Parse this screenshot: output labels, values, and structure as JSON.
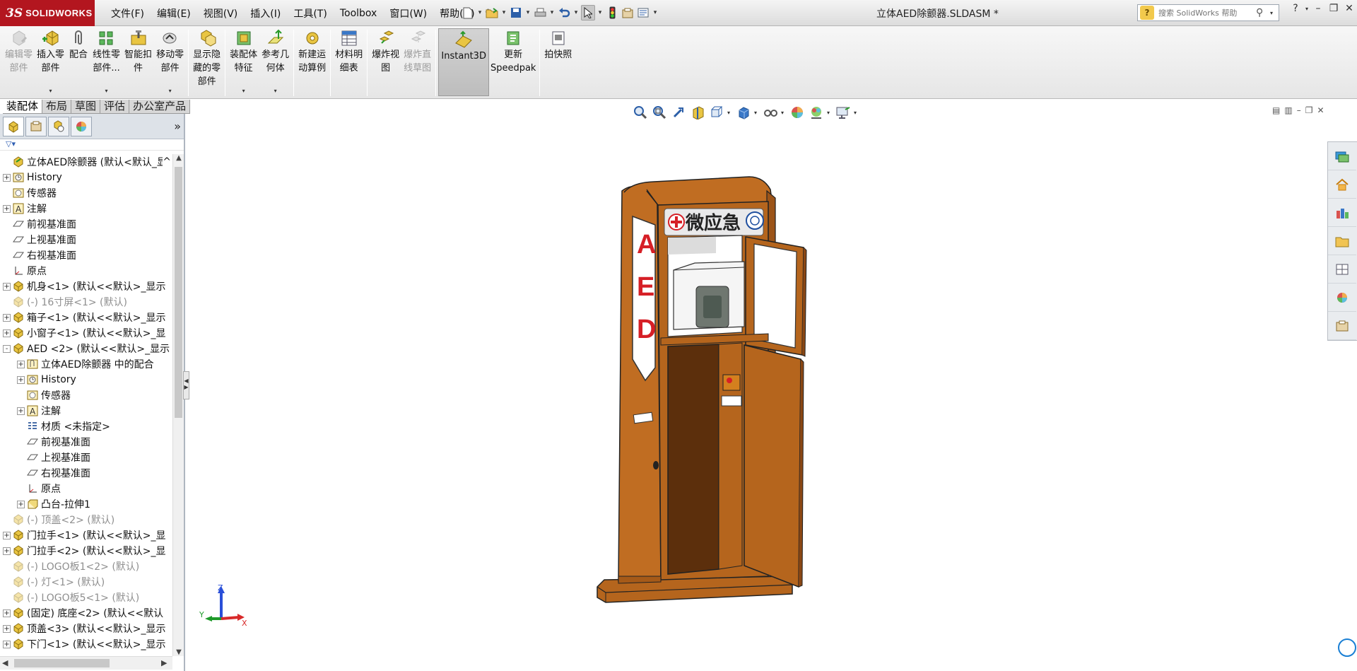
{
  "app": {
    "logo_ds": "3S",
    "logo_brand": "SOLIDWORKS",
    "document_title": "立体AED除颤器.SLDASM *",
    "menu": [
      "文件(F)",
      "编辑(E)",
      "视图(V)",
      "插入(I)",
      "工具(T)",
      "Toolbox",
      "窗口(W)",
      "帮助(H)"
    ],
    "search_placeholder": "搜索 SolidWorks 帮助"
  },
  "ribbon": {
    "edit_part": "编辑零\n部件",
    "insert_parts": "插入零\n部件",
    "mate": "配合",
    "linear_pattern": "线性零\n部件...",
    "smart_fasteners": "智能扣\n件",
    "move_component": "移动零\n部件",
    "show_hidden": "显示隐\n藏的零\n部件",
    "assembly_features": "装配体\n特征",
    "reference_geometry": "参考几\n何体",
    "new_motion_study": "新建运\n动算例",
    "bill_of_materials": "材料明\n细表",
    "exploded_view": "爆炸视\n图",
    "explode_line_sketch": "爆炸直\n线草图",
    "instant3d": "Instant3D",
    "update_speedpak": "更新\nSpeedpak",
    "take_snapshot": "拍快照"
  },
  "tabs": [
    "装配体",
    "布局",
    "草图",
    "评估",
    "办公室产品"
  ],
  "active_tab": 0,
  "tree": [
    {
      "label": "立体AED除颤器 (默认<默认_显示",
      "level": 0,
      "expander": "none",
      "icon": "assembly-icon",
      "suppressed": false
    },
    {
      "label": "History",
      "level": 0,
      "expander": "+",
      "icon": "history-icon",
      "suppressed": false
    },
    {
      "label": "传感器",
      "level": 0,
      "expander": "none",
      "icon": "sensor-icon",
      "suppressed": false
    },
    {
      "label": "注解",
      "level": 0,
      "expander": "+",
      "icon": "annotation-icon",
      "suppressed": false
    },
    {
      "label": "前视基准面",
      "level": 0,
      "expander": "none",
      "icon": "plane-icon",
      "suppressed": false
    },
    {
      "label": "上视基准面",
      "level": 0,
      "expander": "none",
      "icon": "plane-icon",
      "suppressed": false
    },
    {
      "label": "右视基准面",
      "level": 0,
      "expander": "none",
      "icon": "plane-icon",
      "suppressed": false
    },
    {
      "label": "原点",
      "level": 0,
      "expander": "none",
      "icon": "origin-icon",
      "suppressed": false
    },
    {
      "label": "机身<1> (默认<<默认>_显示",
      "level": 0,
      "expander": "+",
      "icon": "part-icon",
      "suppressed": false
    },
    {
      "label": "(-) 16寸屏<1> (默认)",
      "level": 0,
      "expander": "none",
      "icon": "part-icon",
      "suppressed": true
    },
    {
      "label": "箱子<1> (默认<<默认>_显示",
      "level": 0,
      "expander": "+",
      "icon": "part-icon",
      "suppressed": false
    },
    {
      "label": "小窗子<1> (默认<<默认>_显",
      "level": 0,
      "expander": "+",
      "icon": "part-icon",
      "suppressed": false
    },
    {
      "label": "AED <2> (默认<<默认>_显示",
      "level": 0,
      "expander": "-",
      "icon": "part-icon",
      "suppressed": false
    },
    {
      "label": "立体AED除颤器 中的配合",
      "level": 1,
      "expander": "+",
      "icon": "mates-icon",
      "suppressed": false
    },
    {
      "label": "History",
      "level": 1,
      "expander": "+",
      "icon": "history-icon",
      "suppressed": false
    },
    {
      "label": "传感器",
      "level": 1,
      "expander": "none",
      "icon": "sensor-icon",
      "suppressed": false
    },
    {
      "label": "注解",
      "level": 1,
      "expander": "+",
      "icon": "annotation-icon",
      "suppressed": false
    },
    {
      "label": "材质 <未指定>",
      "level": 1,
      "expander": "none",
      "icon": "material-icon",
      "suppressed": false
    },
    {
      "label": "前视基准面",
      "level": 1,
      "expander": "none",
      "icon": "plane-icon",
      "suppressed": false
    },
    {
      "label": "上视基准面",
      "level": 1,
      "expander": "none",
      "icon": "plane-icon",
      "suppressed": false
    },
    {
      "label": "右视基准面",
      "level": 1,
      "expander": "none",
      "icon": "plane-icon",
      "suppressed": false
    },
    {
      "label": "原点",
      "level": 1,
      "expander": "none",
      "icon": "origin-icon",
      "suppressed": false
    },
    {
      "label": "凸台-拉伸1",
      "level": 1,
      "expander": "+",
      "icon": "extrude-icon",
      "suppressed": false
    },
    {
      "label": "(-) 顶盖<2> (默认)",
      "level": 0,
      "expander": "none",
      "icon": "part-icon",
      "suppressed": true
    },
    {
      "label": "门拉手<1> (默认<<默认>_显",
      "level": 0,
      "expander": "+",
      "icon": "part-icon",
      "suppressed": false
    },
    {
      "label": "门拉手<2> (默认<<默认>_显",
      "level": 0,
      "expander": "+",
      "icon": "part-icon",
      "suppressed": false
    },
    {
      "label": "(-) LOGO板1<2> (默认)",
      "level": 0,
      "expander": "none",
      "icon": "part-icon",
      "suppressed": true
    },
    {
      "label": "(-) 灯<1> (默认)",
      "level": 0,
      "expander": "none",
      "icon": "part-icon",
      "suppressed": true
    },
    {
      "label": "(-) LOGO板5<1> (默认)",
      "level": 0,
      "expander": "none",
      "icon": "part-icon",
      "suppressed": true
    },
    {
      "label": "(固定) 底座<2> (默认<<默认",
      "level": 0,
      "expander": "+",
      "icon": "part-icon",
      "suppressed": false
    },
    {
      "label": "顶盖<3> (默认<<默认>_显示",
      "level": 0,
      "expander": "+",
      "icon": "part-icon",
      "suppressed": false
    },
    {
      "label": "下门<1> (默认<<默认>_显示",
      "level": 0,
      "expander": "+",
      "icon": "part-icon",
      "suppressed": false
    }
  ],
  "model": {
    "side_label": "AED",
    "top_label": "微应急"
  },
  "triad": {
    "x": "X",
    "y": "Y",
    "z": "Z"
  },
  "colors": {
    "brand": "#b3161f",
    "cabinet": "#b5651d",
    "cabinet_dark": "#5c2f0c",
    "aed_red": "#d61f26"
  }
}
